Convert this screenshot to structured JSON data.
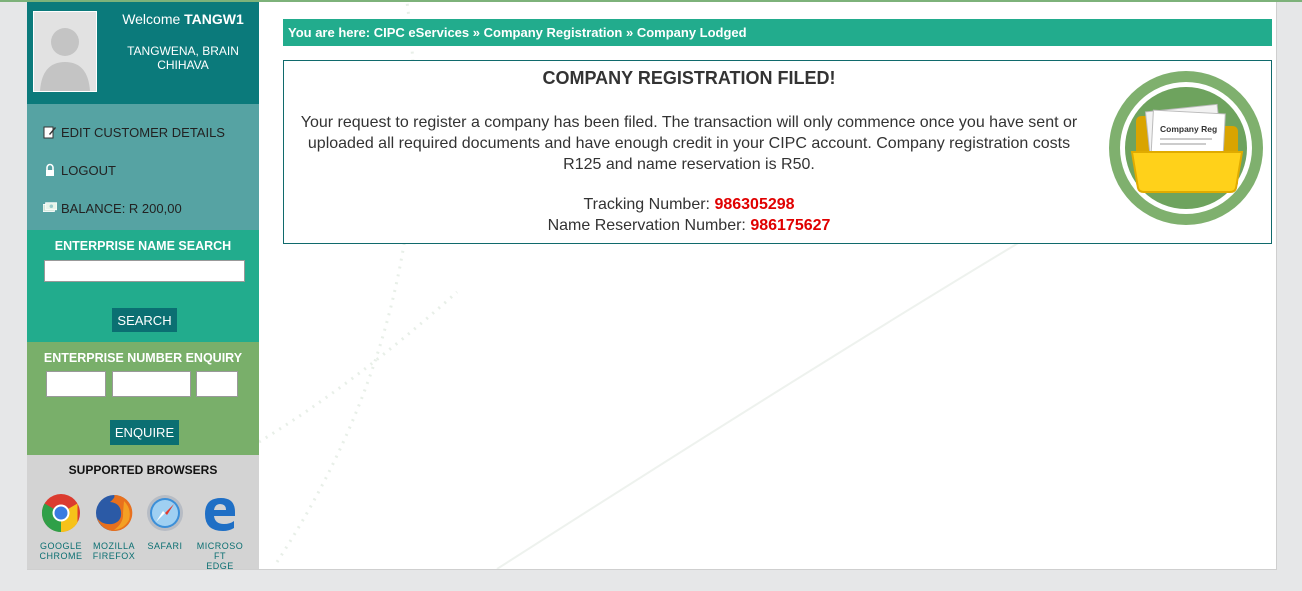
{
  "user": {
    "welcome_prefix": "Welcome",
    "username": "TANGW1",
    "full_name": "TANGWENA, BRAIN CHIHAVA"
  },
  "menu": {
    "items": [
      {
        "label": "EDIT CUSTOMER DETAILS",
        "icon": "edit-icon"
      },
      {
        "label": "LOGOUT",
        "icon": "lock-icon"
      },
      {
        "label": "BALANCE: R 200,00",
        "icon": "money-icon"
      }
    ]
  },
  "name_search": {
    "title": "ENTERPRISE NAME SEARCH",
    "value": "",
    "button": "SEARCH"
  },
  "number_enquiry": {
    "title": "ENTERPRISE NUMBER ENQUIRY",
    "values": [
      "",
      "",
      ""
    ],
    "button": "ENQUIRE"
  },
  "browsers": {
    "title": "SUPPORTED BROWSERS",
    "items": [
      {
        "name": "GOOGLE CHROME",
        "line1": "GOOGLE",
        "line2": "CHROME",
        "icon": "chrome-icon"
      },
      {
        "name": "MOZILLA FIREFOX",
        "line1": "MOZILLA",
        "line2": "FIREFOX",
        "icon": "firefox-icon"
      },
      {
        "name": "SAFARI",
        "line1": "SAFARI",
        "line2": "",
        "icon": "safari-icon"
      },
      {
        "name": "MICROSOFT EDGE",
        "line1": "MICROSO FT",
        "line2": "EDGE",
        "icon": "edge-icon"
      }
    ]
  },
  "breadcrumb": {
    "prefix": "You are here:",
    "items": [
      "CIPC eServices",
      "Company Registration",
      "Company Lodged"
    ],
    "separator": "»"
  },
  "result": {
    "heading": "COMPANY REGISTRATION FILED!",
    "message": "Your request to register a company has been filed. The transaction will only commence once you have sent or uploaded all required documents and have enough credit in your CIPC account. Company registration costs R125 and name reservation is R50.",
    "tracking_label": "Tracking Number:",
    "tracking_number": "986305298",
    "reservation_label": "Name Reservation Number:",
    "reservation_number": "986175627",
    "logo_text": "Company Reg"
  },
  "colors": {
    "teal_dark": "#0b7a7b",
    "teal_menu": "#56a3a3",
    "green_accent": "#22ac8d",
    "green_soft": "#79af6a",
    "button": "#0b6f72",
    "number_red": "#e00000"
  }
}
